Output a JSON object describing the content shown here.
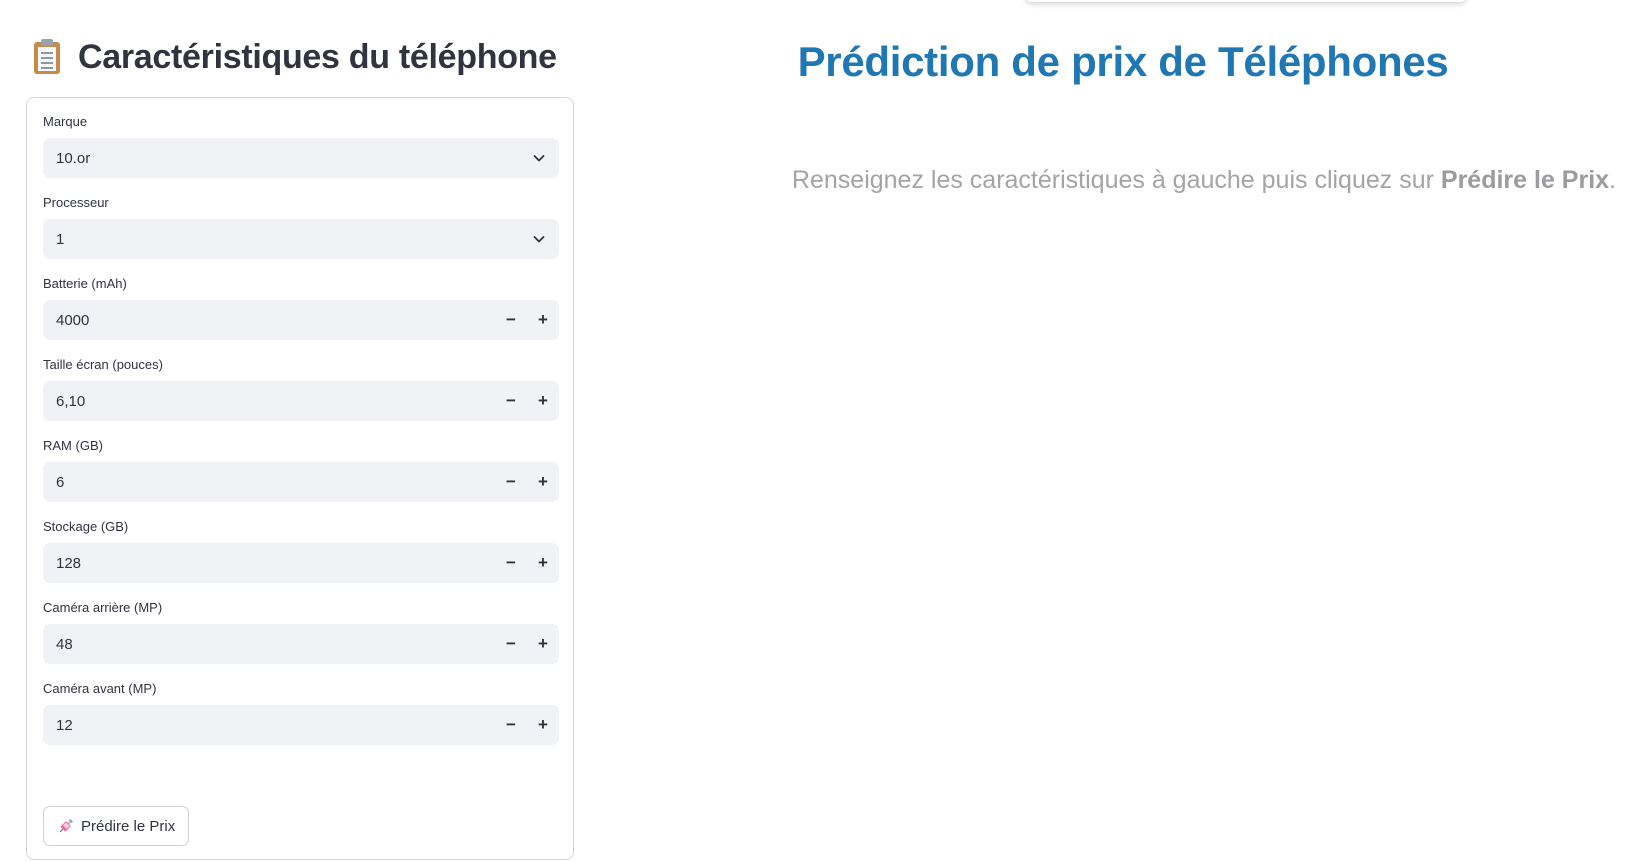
{
  "sidebar": {
    "header_title": "Caractéristiques du téléphone",
    "header_icon": "clipboard-icon",
    "fields": {
      "brand": {
        "label": "Marque",
        "value": "10.or"
      },
      "processor": {
        "label": "Processeur",
        "value": "1"
      },
      "battery": {
        "label": "Batterie (mAh)",
        "value": "4000"
      },
      "screen": {
        "label": "Taille écran (pouces)",
        "value": "6,10"
      },
      "ram": {
        "label": "RAM (GB)",
        "value": "6"
      },
      "storage": {
        "label": "Stockage (GB)",
        "value": "128"
      },
      "rear_camera": {
        "label": "Caméra arrière (MP)",
        "value": "48"
      },
      "front_camera": {
        "label": "Caméra avant (MP)",
        "value": "12"
      }
    },
    "stepper_minus": "−",
    "stepper_plus": "+",
    "predict_button": {
      "label": "Prédire le Prix",
      "icon": "syringe-icon"
    }
  },
  "main": {
    "title": "Prédiction de prix de Téléphones",
    "instructions_prefix": "Renseignez les caractéristiques à gauche puis cliquez sur ",
    "instructions_bold": "Prédire le Prix",
    "instructions_suffix": "."
  },
  "colors": {
    "title_blue": "#1f77b4",
    "input_bg": "#f0f2f6",
    "muted_text": "#a3a3a8"
  }
}
